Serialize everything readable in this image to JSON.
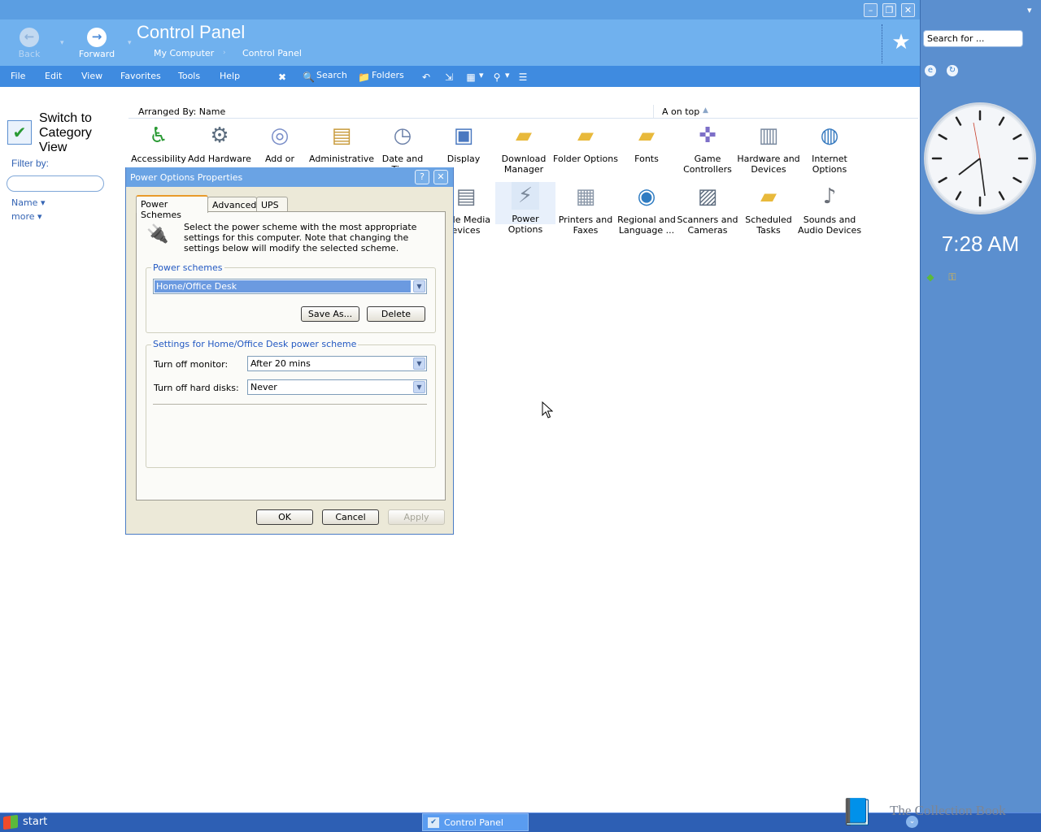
{
  "window": {
    "title": "Control Panel",
    "controls": {
      "minimize": "–",
      "maximize": "❐",
      "close": "✕"
    }
  },
  "nav": {
    "back": "Back",
    "forward": "Forward",
    "breadcrumb": [
      "My Computer",
      "Control Panel"
    ]
  },
  "menu": [
    "File",
    "Edit",
    "View",
    "Favorites",
    "Tools",
    "Help"
  ],
  "toolbar": {
    "search": "Search",
    "folders": "Folders"
  },
  "left_pane": {
    "switch_view": "Switch to Category View",
    "filter_by": "Filter by:",
    "name_link": "Name ▾",
    "more_link": "more ▾"
  },
  "arranged": {
    "label": "Arranged By: Name",
    "sort": "A on top"
  },
  "items": [
    {
      "label": "Accessibility",
      "icon": "accessibility-icon",
      "glyph": "♿",
      "color": "#2a9a34"
    },
    {
      "label": "Add Hardware",
      "icon": "add-hardware-icon",
      "glyph": "🖧",
      "color": "#5a6b7d"
    },
    {
      "label": "Add or",
      "icon": "add-remove-programs-icon",
      "glyph": "💿",
      "color": "#7a8ec8"
    },
    {
      "label": "Administrative",
      "icon": "administrative-tools-icon",
      "glyph": "🗂",
      "color": "#c89b3c"
    },
    {
      "label": "Date and Time",
      "icon": "date-time-icon",
      "glyph": "🕓",
      "color": "#6a7fa8"
    },
    {
      "label": "Display",
      "icon": "display-icon",
      "glyph": "🖥",
      "color": "#4a78c0"
    },
    {
      "label": "Download Manager",
      "icon": "download-manager-icon",
      "glyph": "📁",
      "color": "#e8b93b"
    },
    {
      "label": "Folder Options",
      "icon": "folder-options-icon",
      "glyph": "📂",
      "color": "#e8b93b"
    },
    {
      "label": "Fonts",
      "icon": "fonts-icon",
      "glyph": "📁",
      "color": "#e8b93b"
    },
    {
      "label": "Game Controllers",
      "icon": "game-controllers-icon",
      "glyph": "🎮",
      "color": "#7d6fc8"
    },
    {
      "label": "Hardware and Devices",
      "icon": "hardware-devices-icon",
      "glyph": "🖨",
      "color": "#7a8aa0"
    },
    {
      "label": "Internet Options",
      "icon": "internet-options-icon",
      "glyph": "🌐",
      "color": "#3a7cc0"
    },
    {
      "label": "able Media evices",
      "icon": "portable-media-devices-icon",
      "glyph": "📀",
      "color": "#6c7888"
    },
    {
      "label": "Power Options",
      "icon": "power-options-icon",
      "glyph": "🔌",
      "color": "#7c8a9c"
    },
    {
      "label": "Printers and Faxes",
      "icon": "printers-faxes-icon",
      "glyph": "🖨",
      "color": "#8a97a8"
    },
    {
      "label": "Regional and Language ...",
      "icon": "regional-language-icon",
      "glyph": "🌍",
      "color": "#2f7cc2"
    },
    {
      "label": "Scanners and Cameras",
      "icon": "scanners-cameras-icon",
      "glyph": "📷",
      "color": "#5f6e80"
    },
    {
      "label": "Scheduled Tasks",
      "icon": "scheduled-tasks-icon",
      "glyph": "📂",
      "color": "#e8b93b"
    },
    {
      "label": "Sounds and Audio Devices",
      "icon": "sounds-audio-icon",
      "glyph": "🔊",
      "color": "#6a6f78"
    }
  ],
  "sidebar": {
    "search_placeholder": "Search for ...",
    "time": "7:28 AM"
  },
  "taskbar": {
    "start": "start",
    "task": "Control Panel",
    "watermark": "The Collection Book"
  },
  "dialog": {
    "title": "Power Options Properties",
    "tabs": [
      "Power Schemes",
      "Advanced",
      "UPS"
    ],
    "active_tab": "Power Schemes",
    "description": "Select the power scheme with the most appropriate settings for this computer. Note that changing the settings below will modify the selected scheme.",
    "schemes_group": "Power schemes",
    "scheme_value": "Home/Office Desk",
    "save_as": "Save As...",
    "delete": "Delete",
    "settings_group": "Settings for Home/Office Desk power scheme",
    "monitor_label": "Turn off monitor:",
    "monitor_value": "After 20 mins",
    "disks_label": "Turn off hard disks:",
    "disks_value": "Never",
    "ok": "OK",
    "cancel": "Cancel",
    "apply": "Apply"
  }
}
